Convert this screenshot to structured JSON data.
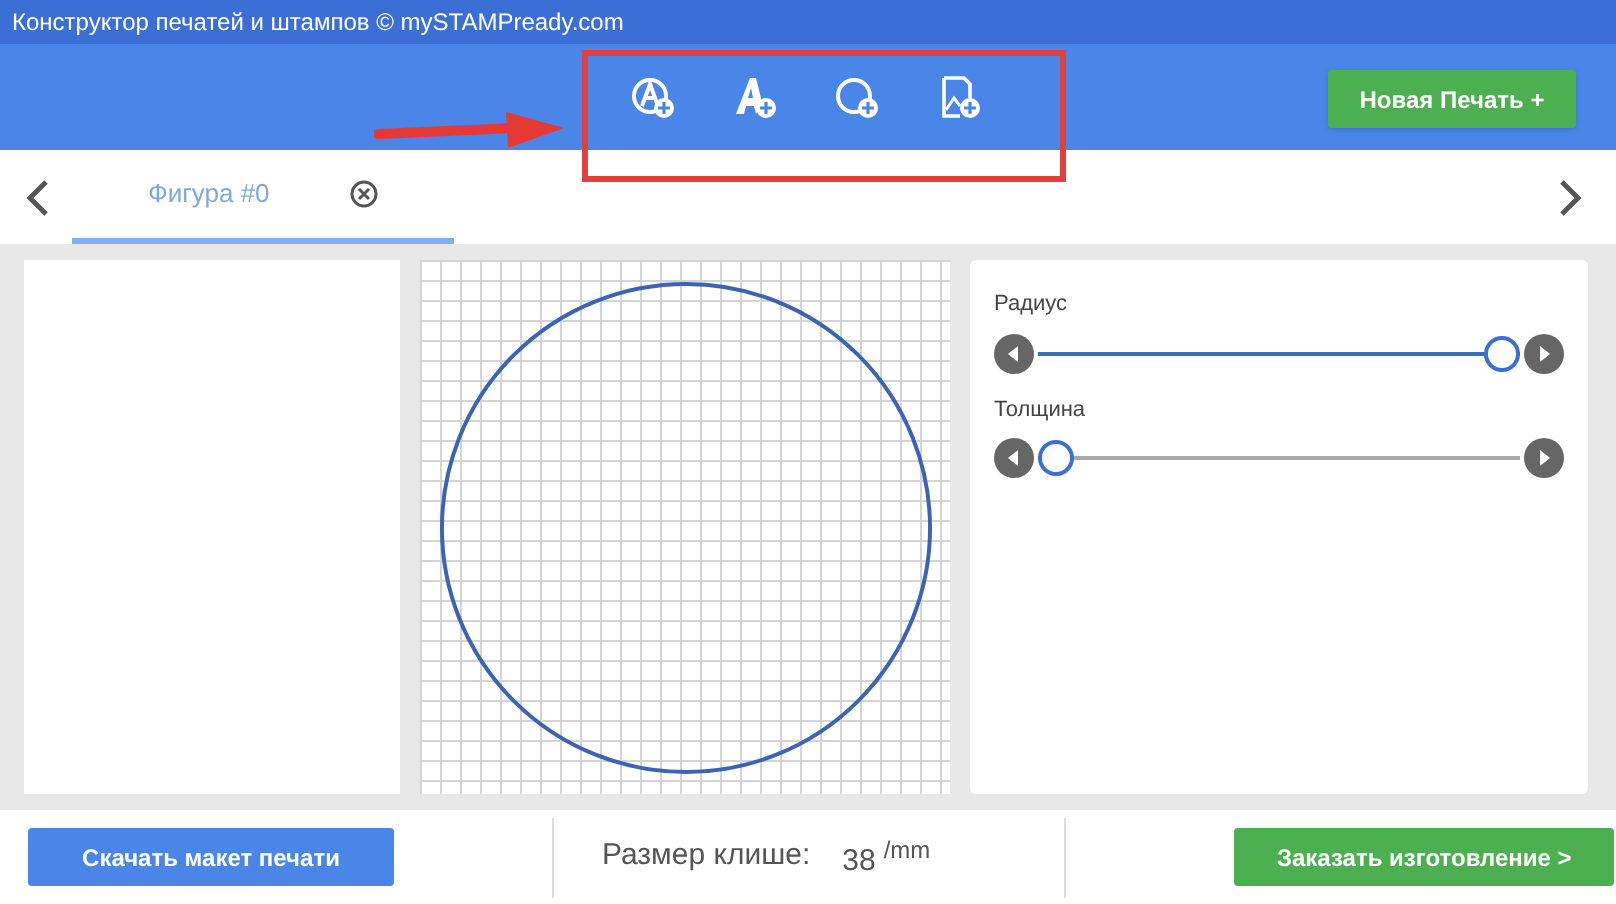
{
  "window": {
    "title": "Конструктор печатей и штампов © mySTAMPready.com"
  },
  "toolbar": {
    "new_button": "Новая Печать +"
  },
  "tabs": [
    {
      "label": "Фигура #0",
      "selected": true
    }
  ],
  "sliders": [
    {
      "label": "Радиус",
      "level": 1.0
    },
    {
      "label": "Толщина",
      "level": 0.0
    }
  ],
  "bottom_bar": {
    "download_button": "Скачать макет печати",
    "size_label": "Размер клише:",
    "size_value": "38",
    "size_unit": "/mm",
    "order_button": "Заказать изготовление >"
  }
}
